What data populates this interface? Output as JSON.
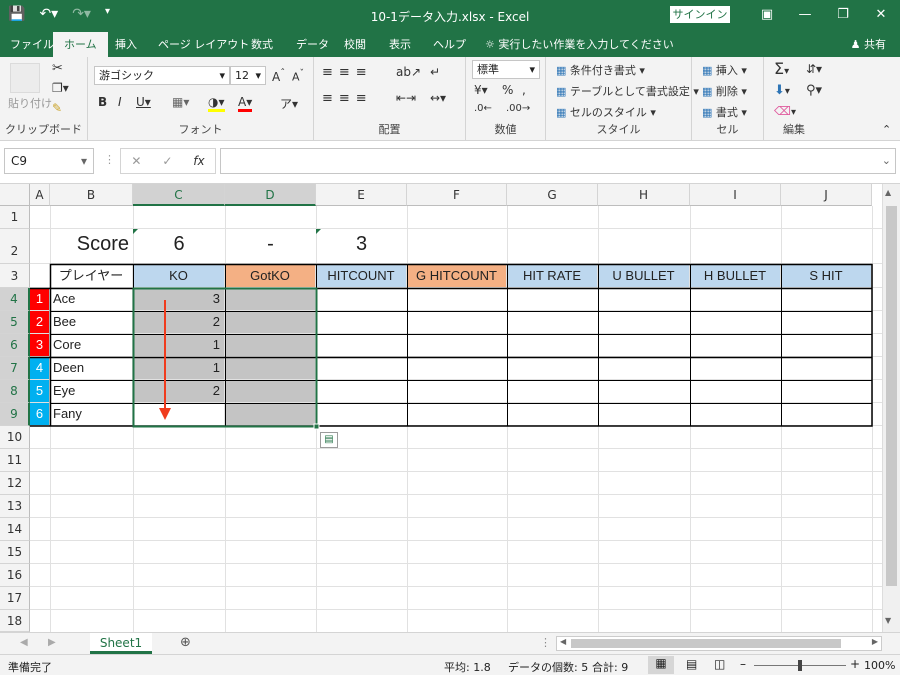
{
  "titlebar": {
    "title": "10-1データ入力.xlsx  -  Excel",
    "signin": "サインイン"
  },
  "tabs": [
    "ファイル",
    "ホーム",
    "挿入",
    "ページ レイアウト",
    "数式",
    "データ",
    "校閲",
    "表示",
    "ヘルプ"
  ],
  "tellme": "実行したい作業を入力してください",
  "share": "共有",
  "ribbon": {
    "paste": "貼り付け",
    "font_name": "游ゴシック",
    "font_size": "12",
    "number_format": "標準",
    "cond_format": "条件付き書式",
    "table_format": "テーブルとして書式設定",
    "cell_style": "セルのスタイル",
    "insert": "挿入",
    "delete": "削除",
    "format": "書式",
    "groups": [
      "クリップボード",
      "フォント",
      "配置",
      "数値",
      "スタイル",
      "セル",
      "編集"
    ]
  },
  "namebox": "C9",
  "fx": "fx",
  "columns": [
    "A",
    "B",
    "C",
    "D",
    "E",
    "F",
    "G",
    "H",
    "I",
    "J"
  ],
  "rows": [
    "1",
    "2",
    "3",
    "4",
    "5",
    "6",
    "7",
    "8",
    "9",
    "10",
    "11",
    "12",
    "13",
    "14",
    "15",
    "16",
    "17",
    "18"
  ],
  "sheet": {
    "score_label": "Score",
    "score_left": "6",
    "score_sep": "-",
    "score_right": "3",
    "headers": [
      "プレイヤー",
      "KO",
      "GotKO",
      "HITCOUNT",
      "G HITCOUNT",
      "HIT RATE",
      "U BULLET",
      "H BULLET",
      "S HIT"
    ],
    "players": [
      {
        "num": "1",
        "name": "Ace",
        "ko": "3"
      },
      {
        "num": "2",
        "name": "Bee",
        "ko": "2"
      },
      {
        "num": "3",
        "name": "Core",
        "ko": "1"
      },
      {
        "num": "4",
        "name": "Deen",
        "ko": "1"
      },
      {
        "num": "5",
        "name": "Eye",
        "ko": "2"
      },
      {
        "num": "6",
        "name": "Fany",
        "ko": ""
      }
    ]
  },
  "sheet_tab": "Sheet1",
  "status": {
    "ready": "準備完了",
    "average": "平均: 1.8",
    "count": "データの個数: 5",
    "sum": "合計: 9",
    "zoom": "100%"
  },
  "colors": {
    "green": "#217346",
    "team_red": "#ff0000",
    "team_blue": "#00b0f0",
    "header_blue": "#bdd7ee",
    "header_orange": "#f4b084",
    "selection_gray": "#c4c4c4",
    "arrow_red": "#f03c1e"
  }
}
